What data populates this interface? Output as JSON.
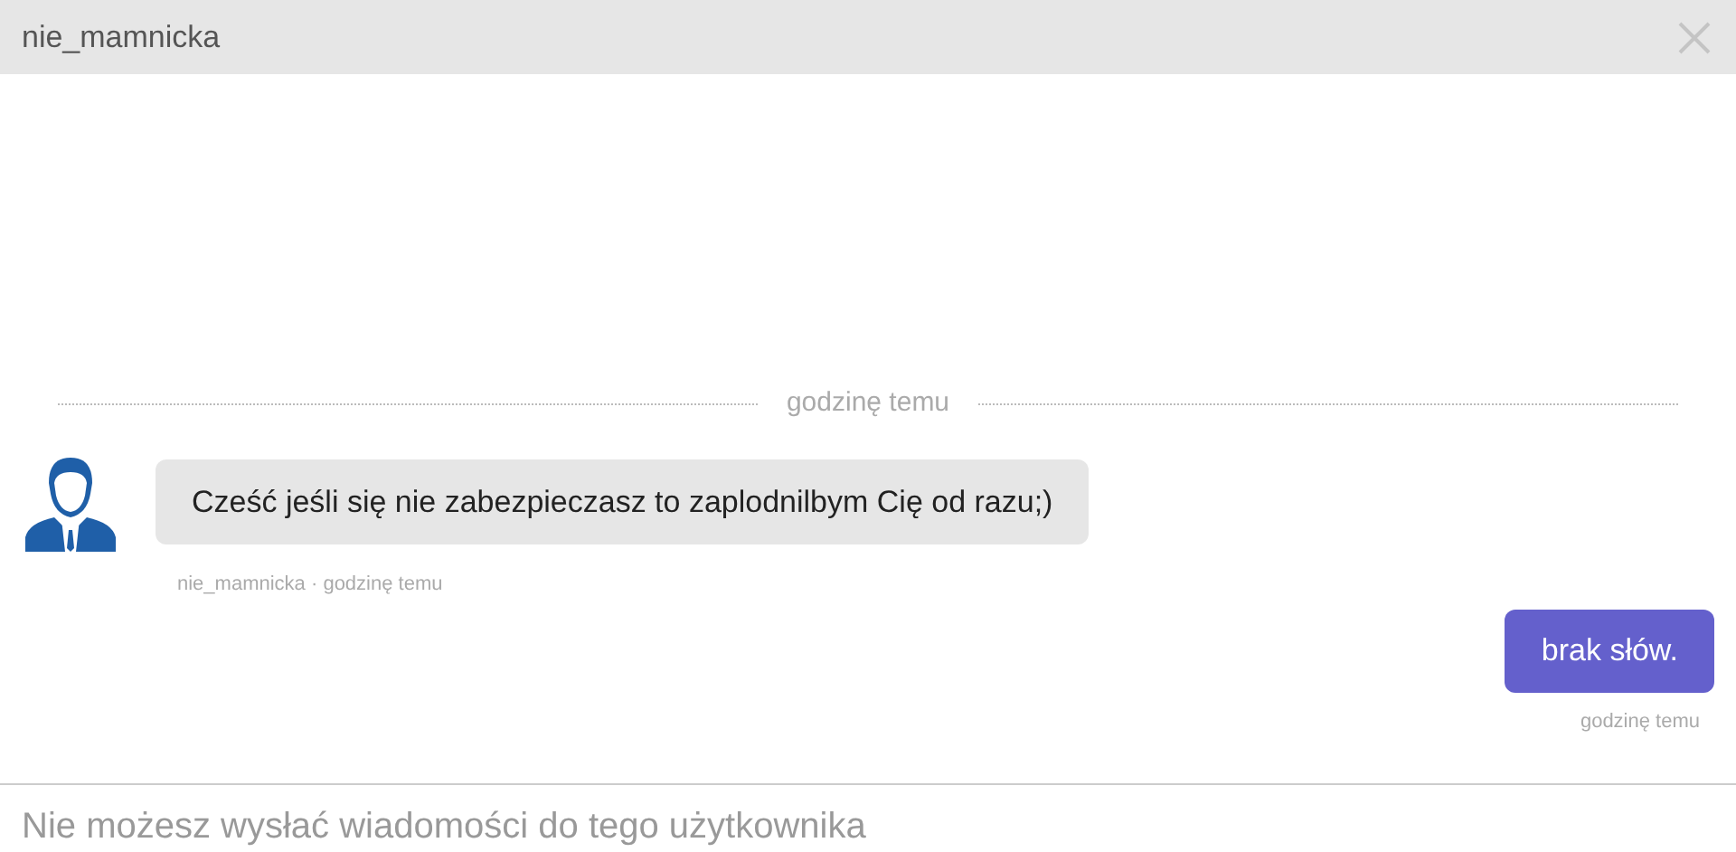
{
  "window": {
    "title": "nie_mamnicka"
  },
  "divider": {
    "label": "godzinę temu"
  },
  "messages": [
    {
      "kind": "received",
      "text": "Cześć jeśli się nie zabezpieczasz to zaplodnilbym Cię od razu;)",
      "meta": "nie_mamnicka · godzinę temu"
    },
    {
      "kind": "sent",
      "text": "brak słów.",
      "meta": "godzinę temu"
    }
  ],
  "composer": {
    "placeholder": "Nie możesz wysłać wiadomości do tego użytkownika"
  }
}
